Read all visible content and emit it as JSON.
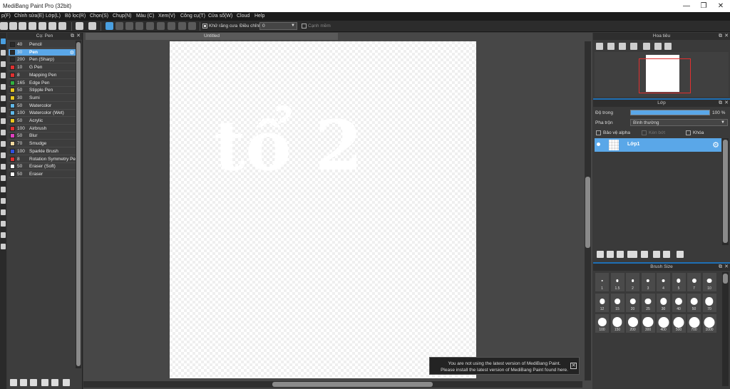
{
  "window": {
    "title": "MediBang Paint Pro (32bit)",
    "minimize": "—",
    "restore": "❐",
    "close": "✕"
  },
  "menu": [
    "p(F)",
    "Chỉnh sửa(E)",
    "Lớp(L)",
    "Bộ lọc(R)",
    "Chọn(S)",
    "Chụp(N)",
    "Màu (C)",
    "Xem(V)",
    "Công cụ(T)",
    "Cửa sổ(W)",
    "Cloud",
    "Help"
  ],
  "toolbar": {
    "antialias_label": "Khử răng cưa",
    "adjust_label": "Điều chỉnh",
    "adjust_value": "0",
    "edge_label": "Cạnh mềm"
  },
  "brush_panel": {
    "title": "Cọ: Pen",
    "items": [
      {
        "size": "40",
        "name": "Pencil",
        "color": "#2b2b2b"
      },
      {
        "size": "30",
        "name": "Pen",
        "color": "#2b2b2b",
        "selected": true
      },
      {
        "size": "200",
        "name": "Pen (Sharp)",
        "color": "#2b2b2b"
      },
      {
        "size": "10",
        "name": "G Pen",
        "color": "#e03030"
      },
      {
        "size": "8",
        "name": "Mapping Pen",
        "color": "#e03030"
      },
      {
        "size": "165",
        "name": "Edge Pen",
        "color": "#30b040"
      },
      {
        "size": "50",
        "name": "Stipple Pen",
        "color": "#e8c820"
      },
      {
        "size": "30",
        "name": "Sumi",
        "color": "#e8c820"
      },
      {
        "size": "50",
        "name": "Watercolor",
        "color": "#60b8e8"
      },
      {
        "size": "100",
        "name": "Watercolor (Wet)",
        "color": "#60b8e8"
      },
      {
        "size": "50",
        "name": "Acrylic",
        "color": "#e8c820"
      },
      {
        "size": "100",
        "name": "Airbrush",
        "color": "#e03030"
      },
      {
        "size": "50",
        "name": "Blur",
        "color": "#e040c0"
      },
      {
        "size": "70",
        "name": "Smudge",
        "color": "#f0d8a0"
      },
      {
        "size": "100",
        "name": "Sparkle Brush",
        "color": "#3050e0"
      },
      {
        "size": "8",
        "name": "Rotation Symmetry Pe",
        "color": "#e03030"
      },
      {
        "size": "50",
        "name": "Eraser (Soft)",
        "color": "#ffffff"
      },
      {
        "size": "50",
        "name": "Eraser",
        "color": "#ffffff"
      }
    ]
  },
  "document": {
    "tab": "Untitled",
    "drawing_text": "tổ 2"
  },
  "notification": {
    "line1": "You are not using the latest version of MediBang Paint.",
    "line2": "Please install the latest version of MediBang Paint found here.",
    "close": "✕"
  },
  "navigator": {
    "title": "Hoa tiêu"
  },
  "layers": {
    "title": "Lớp",
    "opacity_label": "Độ trong",
    "opacity_value": "100 %",
    "opacity": 1.0,
    "blend_label": "Pha trộn",
    "blend_value": "Bình thường",
    "protect_alpha": "Bảo vệ alpha",
    "clipping": "Kèn bớt",
    "lock": "Khóa",
    "layer_name": "Lớp1"
  },
  "brush_size": {
    "title": "Brush Size",
    "sizes": [
      "1",
      "1.5",
      "2",
      "3",
      "4",
      "5",
      "7",
      "10",
      "12",
      "15",
      "20",
      "25",
      "30",
      "40",
      "50",
      "70",
      "100",
      "150",
      "200",
      "300",
      "400",
      "500",
      "700",
      "1000"
    ]
  },
  "colors": {
    "accent": "#5aa7e8",
    "active_tool": "#4a9fe0",
    "nav_frame": "#e23030"
  }
}
